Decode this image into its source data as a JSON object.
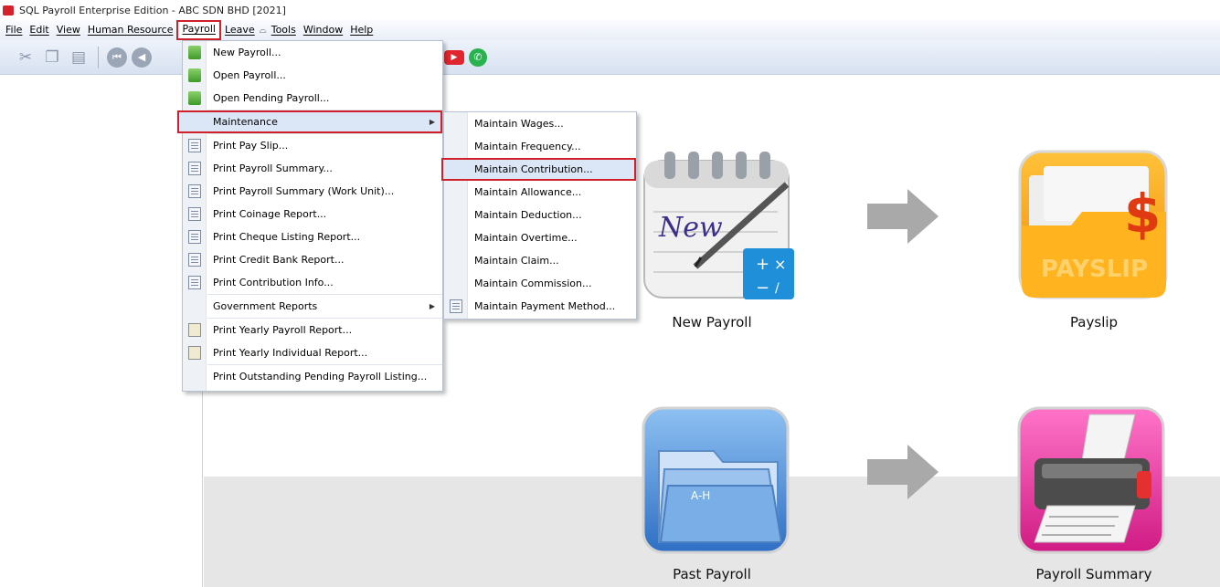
{
  "window": {
    "title": "SQL Payroll Enterprise Edition - ABC SDN BHD [2021]"
  },
  "menubar": {
    "items": [
      {
        "label": "File"
      },
      {
        "label": "Edit"
      },
      {
        "label": "View"
      },
      {
        "label": "Human Resource"
      },
      {
        "label": "Payroll"
      },
      {
        "label": "Leave"
      },
      {
        "label": "Tools"
      },
      {
        "label": "Window"
      },
      {
        "label": "Help"
      }
    ],
    "separator_glyph": "⌓"
  },
  "payroll_menu": {
    "items": [
      {
        "label": "New Payroll..."
      },
      {
        "label": "Open Payroll..."
      },
      {
        "label": "Open Pending Payroll..."
      },
      {
        "label": "Maintenance"
      },
      {
        "label": "Print Pay Slip..."
      },
      {
        "label": "Print Payroll Summary..."
      },
      {
        "label": "Print Payroll Summary (Work Unit)..."
      },
      {
        "label": "Print Coinage Report..."
      },
      {
        "label": "Print Cheque Listing Report..."
      },
      {
        "label": "Print Credit Bank Report..."
      },
      {
        "label": "Print Contribution Info..."
      },
      {
        "label": "Government Reports"
      },
      {
        "label": "Print Yearly Payroll Report..."
      },
      {
        "label": "Print Yearly Individual Report..."
      },
      {
        "label": "Print Outstanding Pending Payroll Listing..."
      }
    ]
  },
  "maintenance_menu": {
    "items": [
      {
        "label": "Maintain Wages..."
      },
      {
        "label": "Maintain Frequency..."
      },
      {
        "label": "Maintain Contribution..."
      },
      {
        "label": "Maintain Allowance..."
      },
      {
        "label": "Maintain Deduction..."
      },
      {
        "label": "Maintain Overtime..."
      },
      {
        "label": "Maintain Claim..."
      },
      {
        "label": "Maintain Commission..."
      },
      {
        "label": "Maintain Payment Method..."
      }
    ]
  },
  "tiles": {
    "new_payroll": {
      "label": "New Payroll",
      "image_text": "New"
    },
    "payslip": {
      "label": "Payslip",
      "image_text": "PAYSLIP"
    },
    "past_payroll": {
      "label": "Past Payroll",
      "image_text": "A-H"
    },
    "payroll_summary": {
      "label": "Payroll Summary"
    }
  },
  "colors": {
    "highlight_box": "#d0202a",
    "menubar_bg": "#e9eef7",
    "payslip_orange": "#f39a10",
    "summary_pink": "#e8369c",
    "past_payroll_blue": "#3f7fd0"
  }
}
